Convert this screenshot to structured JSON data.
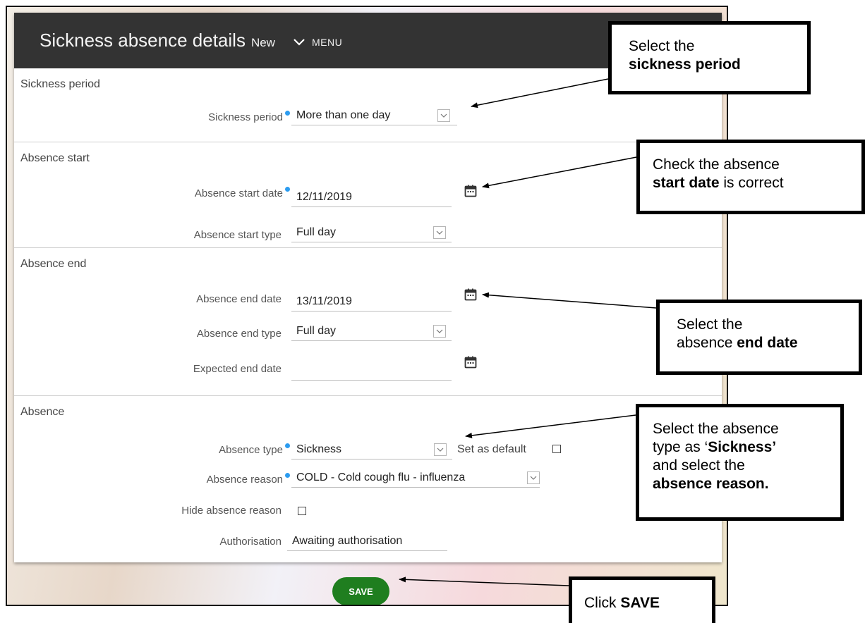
{
  "header": {
    "title": "Sickness absence details",
    "badge": "New",
    "menu_label": "MENU"
  },
  "sections": {
    "sickness_period": {
      "title": "Sickness period",
      "period_label": "Sickness period",
      "period_value": "More than one day"
    },
    "absence_start": {
      "title": "Absence start",
      "date_label": "Absence start date",
      "date_value": "12/11/2019",
      "type_label": "Absence start type",
      "type_value": "Full day"
    },
    "absence_end": {
      "title": "Absence end",
      "date_label": "Absence end date",
      "date_value": "13/11/2019",
      "type_label": "Absence end type",
      "type_value": "Full day",
      "expected_label": "Expected end date",
      "expected_value": ""
    },
    "absence": {
      "title": "Absence",
      "type_label": "Absence type",
      "type_value": "Sickness",
      "set_default_label": "Set as default",
      "reason_label": "Absence reason",
      "reason_value": "COLD - Cold cough flu - influenza",
      "hide_reason_label": "Hide absence reason",
      "authorisation_label": "Authorisation",
      "authorisation_value": "Awaiting authorisation"
    }
  },
  "save_label": "SAVE",
  "callouts": {
    "sickness_period": {
      "line1": "Select the",
      "bold": "sickness period"
    },
    "start_date": {
      "line1": "Check the absence",
      "bold": "start date",
      "tail": " is correct"
    },
    "end_date": {
      "line1": "Select the",
      "pre": "absence ",
      "bold": "end date"
    },
    "absence_type": {
      "line1": "Select the absence",
      "pre2": "type as ‘",
      "bold2": "Sickness’",
      "line3": "and select the",
      "bold4": "absence reason."
    },
    "save": {
      "pre": "Click ",
      "bold": "SAVE"
    }
  },
  "colors": {
    "topbar": "#333333",
    "save_button": "#1f7e1f",
    "required_dot": "#2c9cf0"
  }
}
